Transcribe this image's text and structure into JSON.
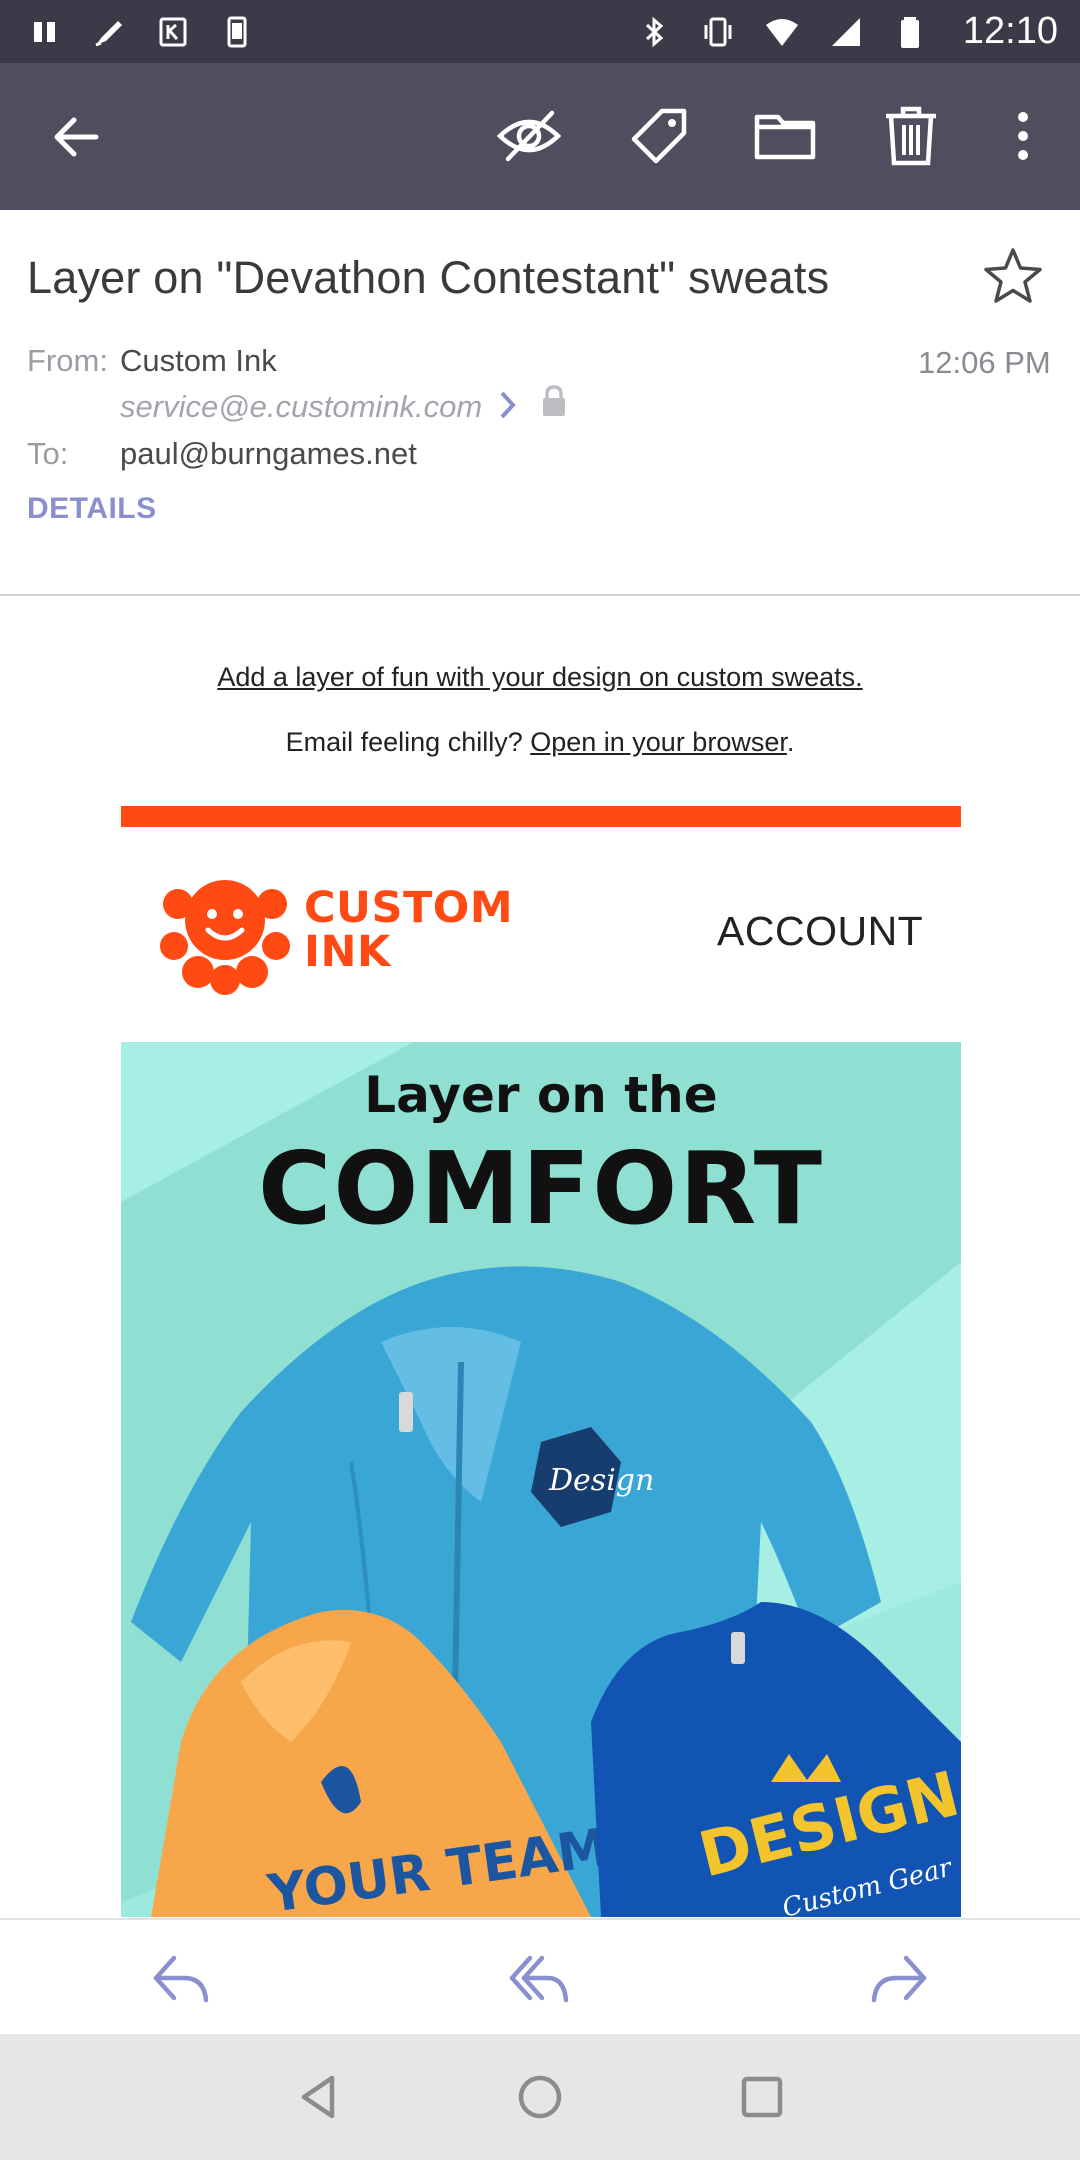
{
  "status_bar": {
    "time": "12:10"
  },
  "app_bar": {
    "icons": [
      "back-arrow-icon",
      "eye-off-icon",
      "tag-icon",
      "folder-icon",
      "trash-icon",
      "more-vert-icon"
    ]
  },
  "email": {
    "subject": "Layer on \"Devathon Contestant\" sweats",
    "from_label": "From:",
    "from_name": "Custom Ink",
    "from_email": "service@e.customink.com",
    "to_label": "To:",
    "to_value": "paul@burngames.net",
    "time": "12:06 PM",
    "details_label": "DETAILS"
  },
  "body": {
    "preheader": "Add a layer of fun with your design on custom sweats.",
    "chilly_prefix": "Email feeling chilly? ",
    "chilly_link": "Open in your browser",
    "chilly_suffix": ".",
    "logo_line1": "CUSTOM",
    "logo_line2": "INK",
    "account_link": "ACCOUNT",
    "hero_line1": "Layer on the",
    "hero_line2": "COMFORT",
    "hero_patch": "Design",
    "hero_team": "YOUR TEAM",
    "hero_design": "DESIGN",
    "hero_gear": "Custom Gear"
  },
  "colors": {
    "brand_orange": "#ff4a14",
    "hero_bg": "#a7efe4",
    "appbar": "#4e4e5e",
    "statusbar": "#3a3a48",
    "details_link": "#8a8fcf"
  }
}
